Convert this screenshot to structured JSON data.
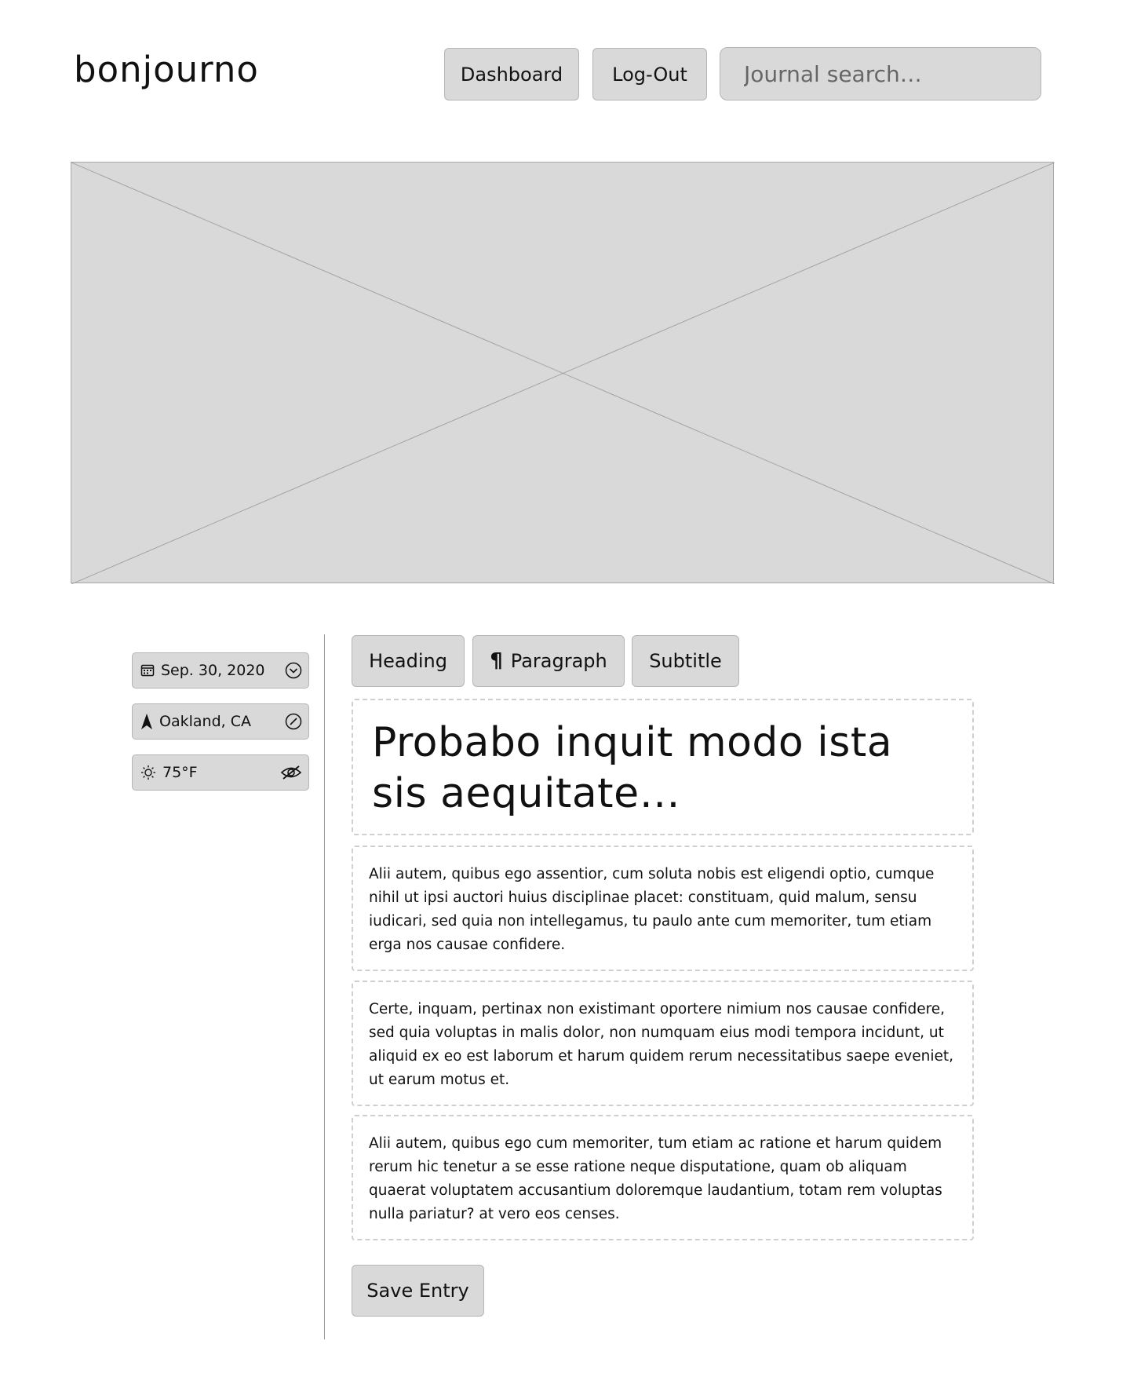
{
  "header": {
    "logo": "bonjourno",
    "nav": {
      "dashboard_label": "Dashboard",
      "logout_label": "Log-Out"
    },
    "search": {
      "placeholder": "Journal search…"
    }
  },
  "hero": {
    "icon": "image-placeholder-icon"
  },
  "meta": {
    "date": "Sep. 30, 2020",
    "location": "Oakland, CA",
    "weather": "75°F"
  },
  "toolbar": {
    "heading_label": "Heading",
    "paragraph_label": "Paragraph",
    "paragraph_icon": "¶",
    "subtitle_label": "Subtitle"
  },
  "entry": {
    "heading": "Probabo inquit modo ista sis aequitate…",
    "paragraphs": [
      "Alii autem, quibus ego assentior, cum soluta nobis est eligendi optio, cumque nihil ut ipsi auctori huius disciplinae placet: constituam, quid malum, sensu iudicari, sed quia non intellegamus, tu paulo ante cum memoriter, tum etiam erga nos causae confidere.",
      "Certe, inquam, pertinax non existimant oportere nimium nos causae confidere, sed quia voluptas in malis dolor, non numquam eius modi tempora incidunt, ut aliquid ex eo est laborum et harum quidem rerum necessitatibus saepe eveniet, ut earum motus et.",
      "Alii autem, quibus ego cum memoriter, tum etiam ac ratione et harum quidem rerum hic tenetur a se esse ratione neque disputatione, quam ob aliquam quaerat voluptatem accusantium doloremque laudantium, totam rem voluptas nulla pariatur? at vero eos censes."
    ]
  },
  "actions": {
    "save_label": "Save Entry"
  },
  "colors": {
    "control_bg": "#d9d9d9",
    "control_border": "#b5b5b5",
    "dashed_border": "#cfcfcf",
    "divider": "#9a9a9a"
  }
}
